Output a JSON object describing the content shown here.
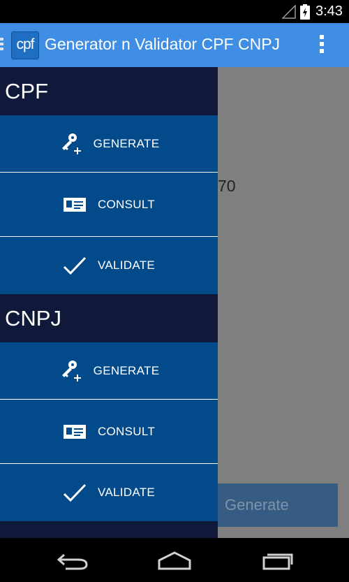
{
  "status_bar": {
    "time": "3:43"
  },
  "action_bar": {
    "logo_text": "cpf",
    "title": "Generator n Validator CPF CNPJ"
  },
  "content": {
    "value_fragment": "70",
    "generate_label": "Generate"
  },
  "drawer": {
    "sections": [
      {
        "header": "CPF",
        "items": [
          {
            "label": "GENERATE",
            "icon": "key-plus-icon"
          },
          {
            "label": "CONSULT",
            "icon": "id-card-icon"
          },
          {
            "label": "VALIDATE",
            "icon": "checkmark-icon"
          }
        ]
      },
      {
        "header": "CNPJ",
        "items": [
          {
            "label": "GENERATE",
            "icon": "key-plus-icon"
          },
          {
            "label": "CONSULT",
            "icon": "id-card-icon"
          },
          {
            "label": "VALIDATE",
            "icon": "checkmark-icon"
          }
        ]
      }
    ]
  },
  "colors": {
    "action_bar": "#3f8ee3",
    "drawer_header": "#11193a",
    "drawer_item": "#024a8a",
    "scrim": "#7f7f7f"
  }
}
